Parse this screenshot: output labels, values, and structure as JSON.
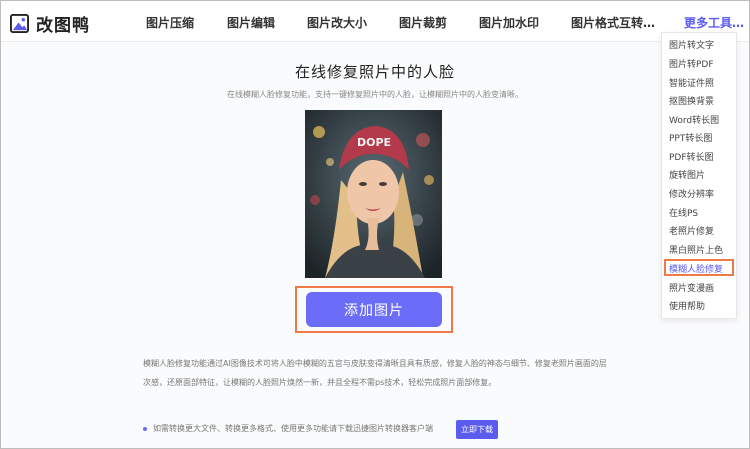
{
  "brand": {
    "name": "改图鸭",
    "accent": "#5a5cf0",
    "highlight": "#f07a47"
  },
  "nav": {
    "items": [
      "图片压缩",
      "图片编辑",
      "图片改大小",
      "图片裁剪",
      "图片加水印",
      "图片格式互转…"
    ],
    "more": "更多工具…"
  },
  "dropdown": {
    "items": [
      "图片转文字",
      "图片转PDF",
      "智能证件照",
      "抠图换背景",
      "Word转长图",
      "PPT转长图",
      "PDF转长图",
      "旋转图片",
      "修改分辨率",
      "在线PS",
      "老照片修复",
      "黑白照片上色",
      "模糊人脸修复",
      "照片变漫画",
      "使用帮助"
    ],
    "active_index": 12
  },
  "main": {
    "title": "在线修复照片中的人脸",
    "subtitle": "在线模糊人脸修复功能，支持一键修复照片中的人脸，让模糊照片中的人脸变清晰。",
    "upload_label": "添加图片",
    "description": "模糊人脸修复功能通过AI图像技术可将人脸中模糊的五官与皮肤变得清晰且具有质感，修复人脸的神态与细节、修复老照片画面的层次感，还原面部特征，让模糊的人脸照片焕然一新，并且全程不需ps技术，轻松完成照片面部修复。",
    "tip": "如需转换更大文件、转换更多格式、使用更多功能请下载迅捷图片转换器客户端",
    "download_label": "立即下载"
  },
  "icons": {
    "logo": "picture-logo-icon",
    "bullet": "dot-icon"
  }
}
